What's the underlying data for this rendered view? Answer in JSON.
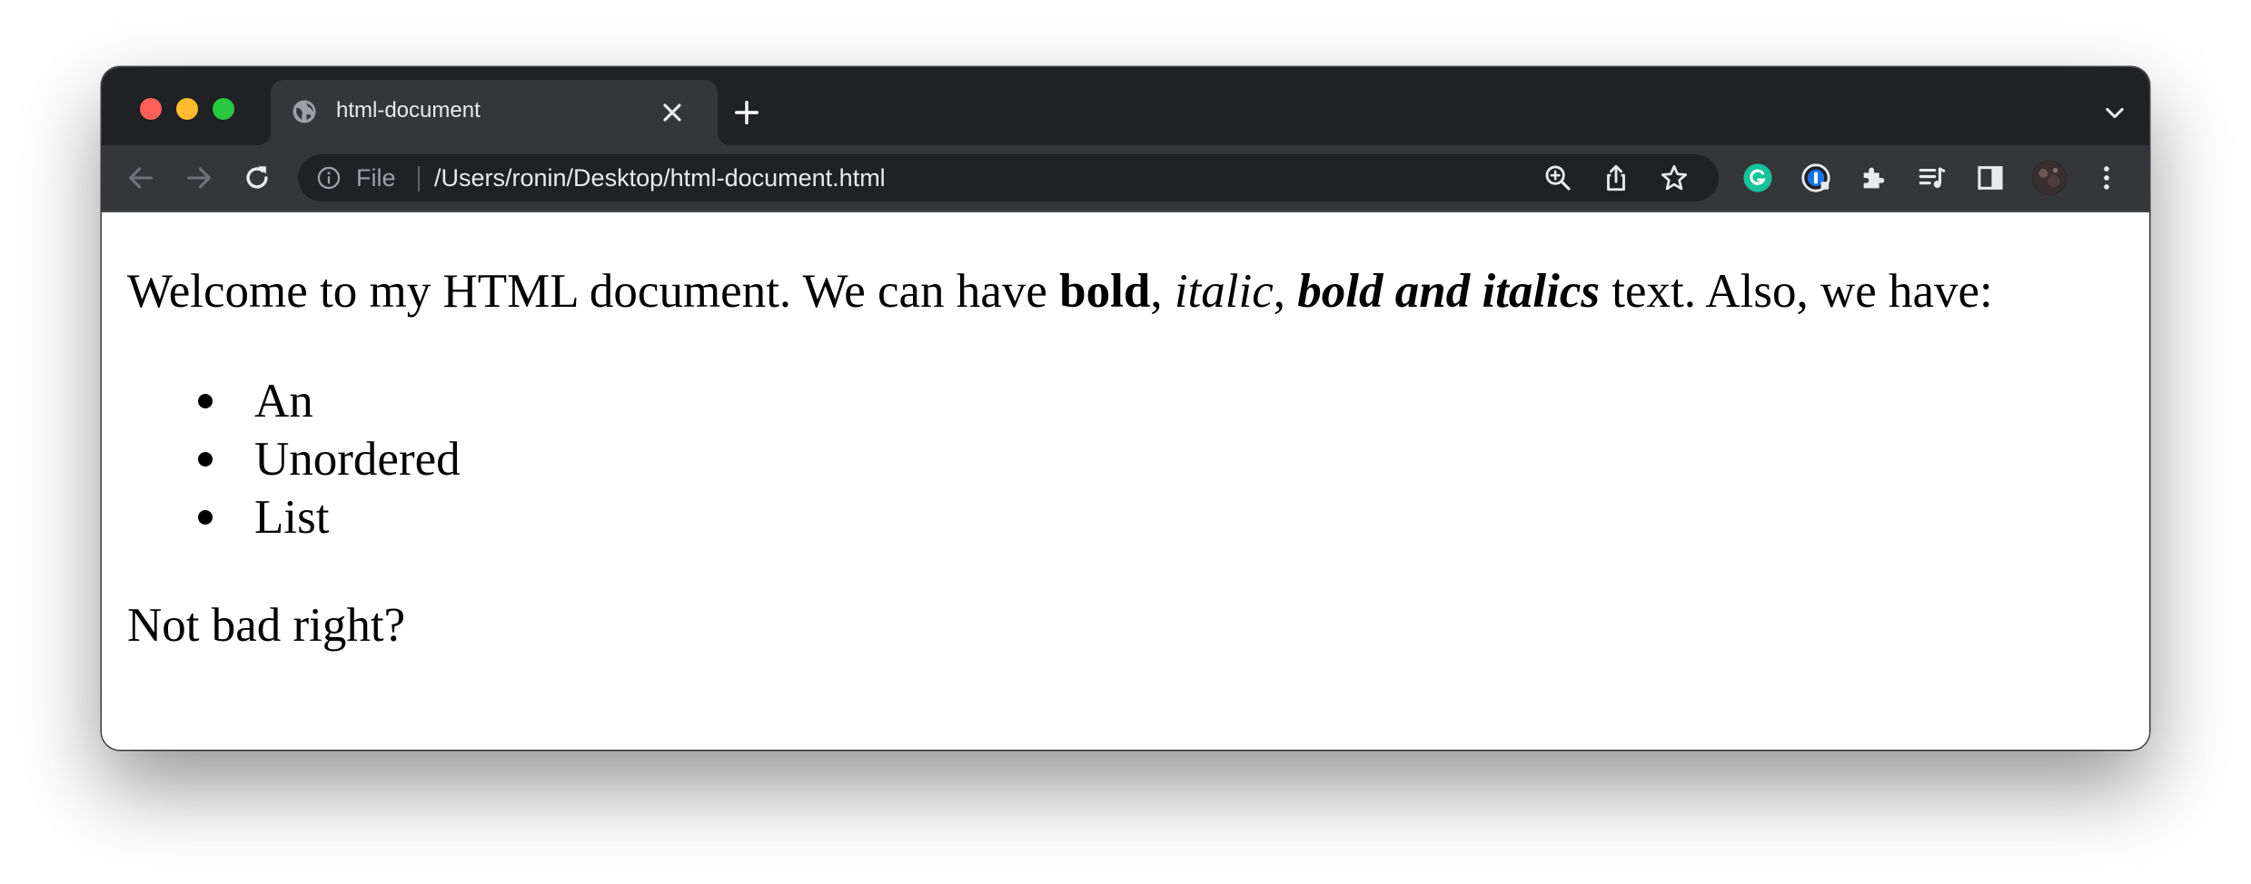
{
  "browser": {
    "tab": {
      "title": "html-document",
      "favicon": "globe-icon"
    },
    "address_bar": {
      "security_icon": "info-icon",
      "scheme_label": "File",
      "url": "/Users/ronin/Desktop/html-document.html"
    },
    "omnibox_actions": [
      "zoom-icon",
      "share-icon",
      "bookmark-star-icon"
    ],
    "extensions": [
      "grammarly-icon",
      "password-manager-icon",
      "extensions-puzzle-icon",
      "reading-list-icon",
      "side-panel-icon",
      "profile-avatar",
      "menu-kebab-icon"
    ],
    "colors": {
      "tabstrip_bg": "#202124",
      "toolbar_bg": "#35363a",
      "traffic_red": "#ff5f57",
      "traffic_yellow": "#febc2e",
      "traffic_green": "#28c840",
      "grammarly": "#15c39a"
    }
  },
  "document": {
    "paragraph1": {
      "text_before": "Welcome to my HTML document. We can have ",
      "bold": "bold",
      "sep1": ", ",
      "italic": "italic",
      "sep2": ", ",
      "bold_italic": "bold and italics",
      "text_after": " text. Also, we have:"
    },
    "list_items": [
      "An",
      "Unordered",
      "List"
    ],
    "paragraph2": "Not bad right?"
  }
}
